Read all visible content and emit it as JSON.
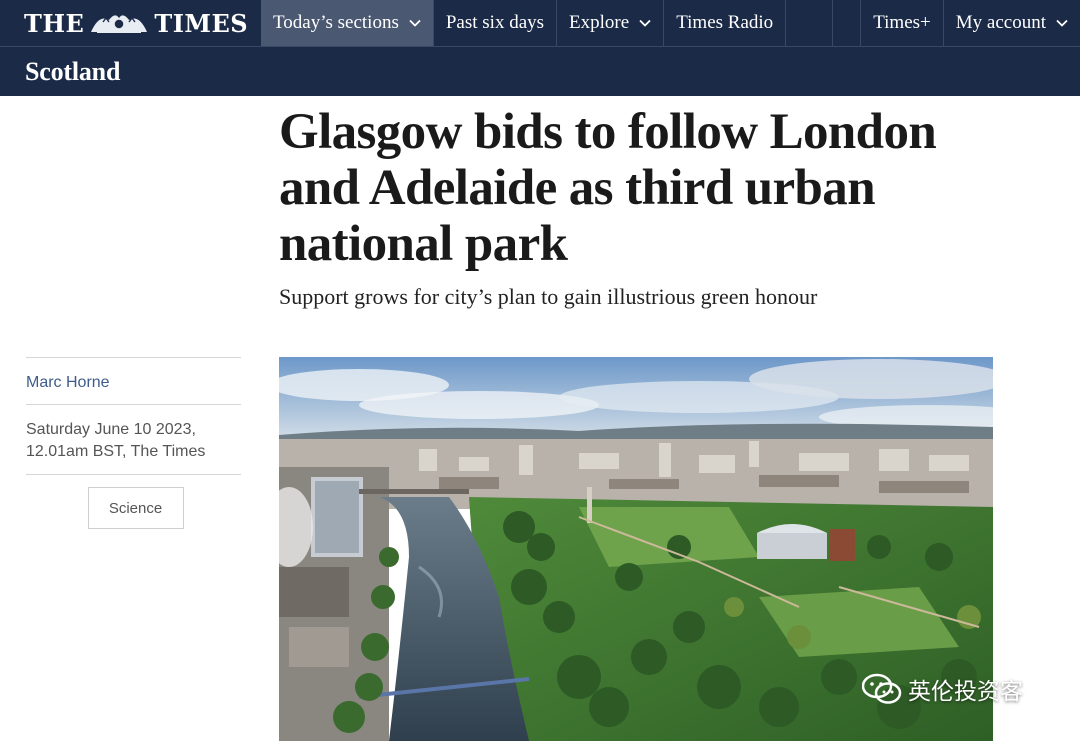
{
  "header": {
    "logo_left": "THE",
    "logo_right": "TIMES",
    "nav": [
      {
        "label": "Today’s sections",
        "dropdown": true,
        "active": true
      },
      {
        "label": "Past six days",
        "dropdown": false
      },
      {
        "label": "Explore",
        "dropdown": true
      },
      {
        "label": "Times Radio",
        "dropdown": false
      }
    ],
    "right_nav": [
      {
        "label": "Times+",
        "dropdown": false
      },
      {
        "label": "My account",
        "dropdown": true
      }
    ]
  },
  "section": {
    "title": "Scotland"
  },
  "article": {
    "headline": "Glasgow bids to follow London and Adelaide as third urban national park",
    "standfirst": "Support grows for city’s plan to gain illustrious green honour",
    "author": "Marc Horne",
    "date_line1": "Saturday June 10 2023,",
    "date_line2": "12.01am BST, The Times",
    "tag": "Science"
  },
  "watermark": {
    "text": "英伦投资客"
  },
  "colors": {
    "navy": "#1b2a47",
    "active_tab": "#4a5872",
    "link": "#3f5d8a"
  },
  "icons": {
    "crest": "royal-crest-icon",
    "chevron": "chevron-down-icon",
    "watermark": "wechat-icon"
  }
}
